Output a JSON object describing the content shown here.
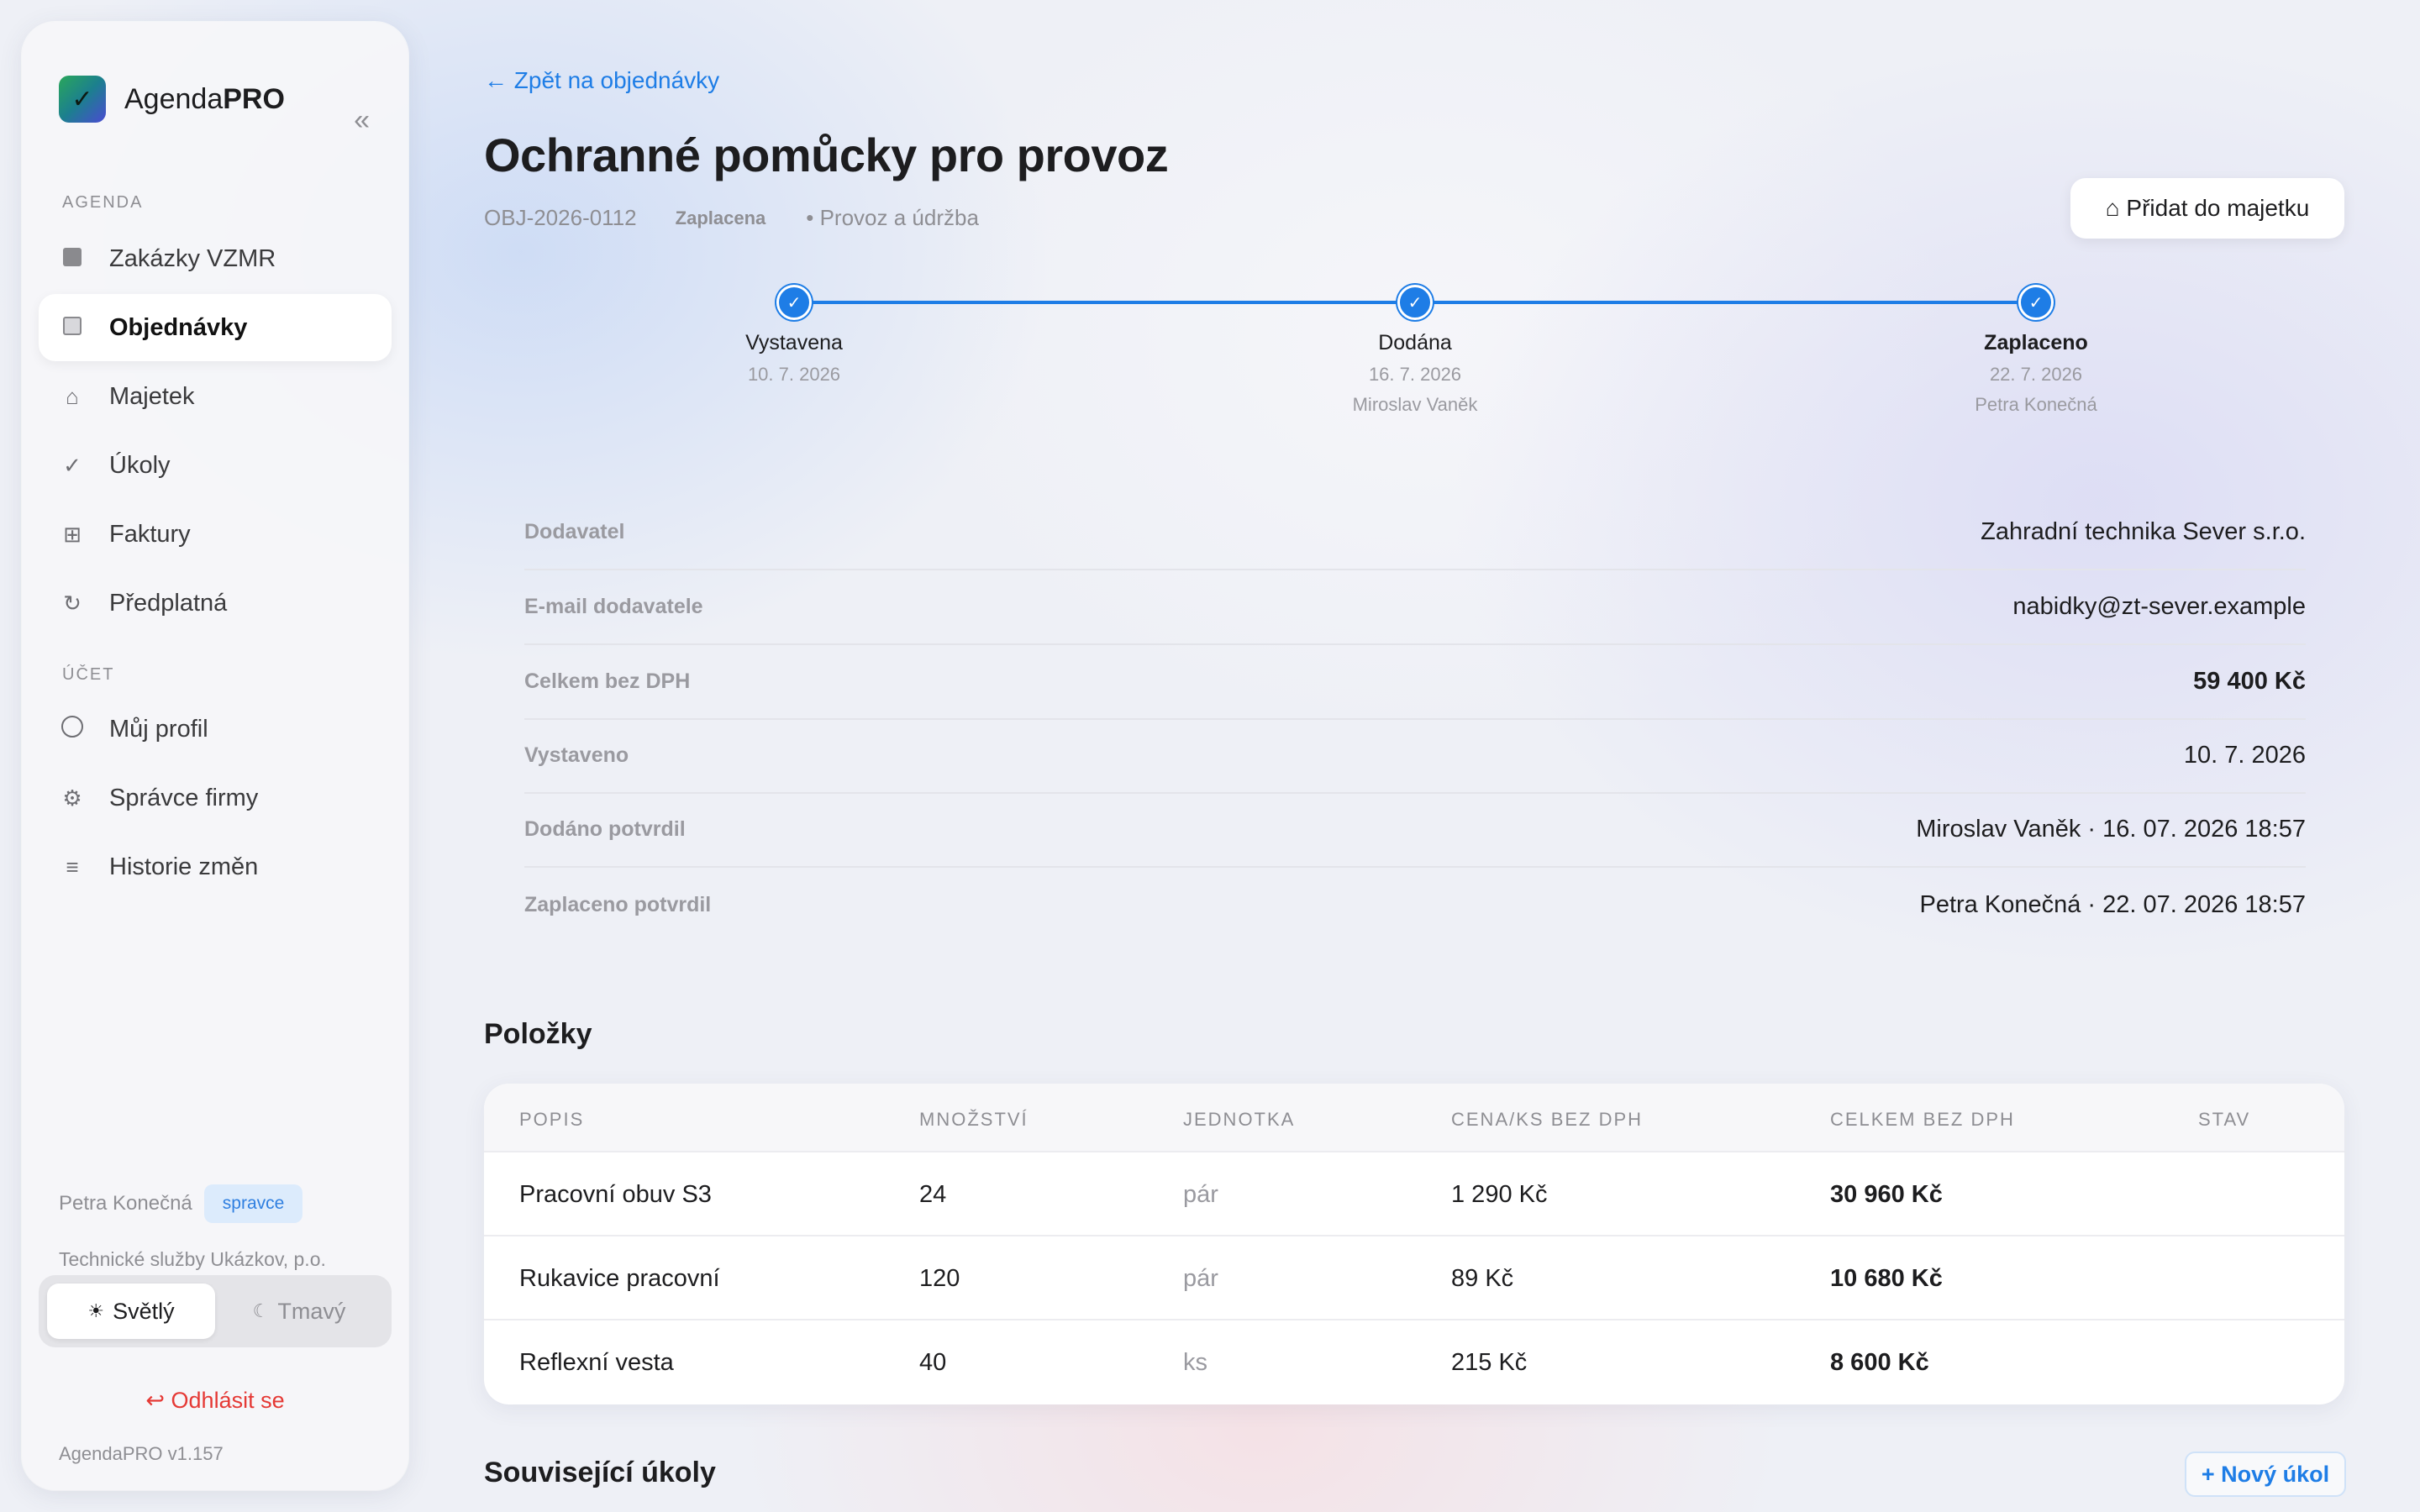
{
  "app": {
    "name_regular": "Agenda",
    "name_bold": "PRO",
    "collapse_icon": "«"
  },
  "sidebar": {
    "section_agenda": "AGENDA",
    "section_account": "ÚČET",
    "agenda_items": [
      {
        "label": "Zakázky VZMR",
        "icon": "square-icon"
      },
      {
        "label": "Objednávky",
        "icon": "square-outline-icon",
        "active": true
      },
      {
        "label": "Majetek",
        "icon": "home-icon"
      },
      {
        "label": "Úkoly",
        "icon": "check-icon"
      },
      {
        "label": "Faktury",
        "icon": "grid-icon"
      },
      {
        "label": "Předplatná",
        "icon": "refresh-icon"
      }
    ],
    "account_items": [
      {
        "label": "Můj profil",
        "icon": "circle-icon"
      },
      {
        "label": "Správce firmy",
        "icon": "gear-icon"
      },
      {
        "label": "Historie změn",
        "icon": "list-icon"
      }
    ],
    "user_name": "Petra Konečná",
    "user_role": "spravce",
    "organization": "Technické služby Ukázkov, p.o.",
    "theme_light": "Světlý",
    "theme_dark": "Tmavý",
    "logout": "Odhlásit se",
    "version": "AgendaPRO v1.157"
  },
  "header": {
    "back_link": "← Zpět na objednávky",
    "title": "Ochranné pomůcky pro provoz",
    "order_id": "OBJ-2026-0112",
    "status": "Zaplacena",
    "department": "• Provoz a údržba",
    "add_asset_button": "⌂ Přidat do majetku"
  },
  "timeline": [
    {
      "label": "Vystavena",
      "date": "10. 7. 2026",
      "person": "",
      "active": false
    },
    {
      "label": "Dodána",
      "date": "16. 7. 2026",
      "person": "Miroslav Vaněk",
      "active": false
    },
    {
      "label": "Zaplaceno",
      "date": "22. 7. 2026",
      "person": "Petra Konečná",
      "active": true
    }
  ],
  "details": [
    {
      "label": "Dodavatel",
      "value": "Zahradní technika Sever s.r.o."
    },
    {
      "label": "E-mail dodavatele",
      "value": "nabidky@zt-sever.example"
    },
    {
      "label": "Celkem bez DPH",
      "value": "59 400 Kč"
    },
    {
      "label": "Vystaveno",
      "value": "10. 7. 2026"
    },
    {
      "label": "Dodáno potvrdil",
      "value": "Miroslav Vaněk · 16. 07. 2026 18:57"
    },
    {
      "label": "Zaplaceno potvrdil",
      "value": "Petra Konečná · 22. 07. 2026 18:57"
    }
  ],
  "items": {
    "title": "Položky",
    "columns": [
      "POPIS",
      "MNOŽSTVÍ",
      "JEDNOTKA",
      "CENA/KS BEZ DPH",
      "CELKEM BEZ DPH",
      "STAV"
    ],
    "rows": [
      {
        "description": "Pracovní obuv S3",
        "quantity": "24",
        "unit": "pár",
        "unit_price": "1 290 Kč",
        "total": "30 960 Kč",
        "status": ""
      },
      {
        "description": "Rukavice pracovní",
        "quantity": "120",
        "unit": "pár",
        "unit_price": "89 Kč",
        "total": "10 680 Kč",
        "status": ""
      },
      {
        "description": "Reflexní vesta",
        "quantity": "40",
        "unit": "ks",
        "unit_price": "215 Kč",
        "total": "8 600 Kč",
        "status": ""
      }
    ]
  },
  "related_tasks": {
    "title": "Související úkoly",
    "new_task_button": "+ Nový úkol"
  },
  "colors": {
    "accent": "#1e7de6",
    "danger": "#e53935",
    "text": "#1d1d1f",
    "muted": "#8e8e93"
  }
}
